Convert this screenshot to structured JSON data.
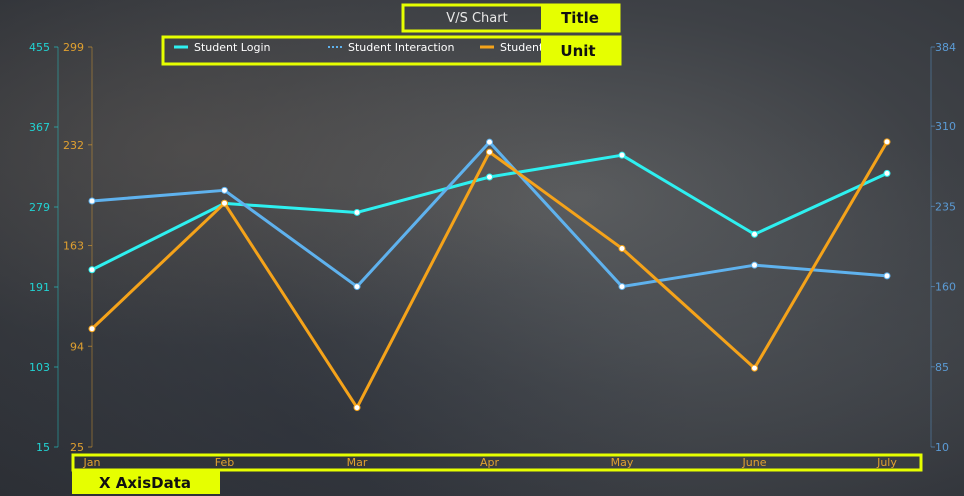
{
  "chart_data": {
    "type": "line",
    "title": "V/S Chart",
    "categories": [
      "Jan",
      "Feb",
      "Mar",
      "Apr",
      "May",
      "June",
      "July"
    ],
    "axes": {
      "y_left_outer": {
        "ticks": [
          15,
          103,
          191,
          279,
          367,
          455
        ],
        "range": [
          15,
          455
        ],
        "color": "#22d3d3"
      },
      "y_left_inner": {
        "ticks": [
          25,
          94,
          163,
          232,
          299
        ],
        "range": [
          25,
          299
        ],
        "color": "#e0a030"
      },
      "y_right": {
        "ticks": [
          10,
          85,
          160,
          235,
          310,
          384
        ],
        "range": [
          10,
          384
        ],
        "color": "#5b9bd5"
      }
    },
    "series": [
      {
        "name": "Student Login",
        "axis": "y_left_outer",
        "color": "#2ef0f0",
        "values": [
          210,
          283,
          273,
          312,
          336,
          249,
          316
        ]
      },
      {
        "name": "Student Interaction",
        "axis": "y_right",
        "color": "#5fb2ee",
        "values": [
          240,
          250,
          160,
          295,
          160,
          180,
          170
        ]
      },
      {
        "name": "Student",
        "axis": "y_left_inner",
        "color": "#f5a31a",
        "values": [
          106,
          192,
          52,
          227,
          161,
          79,
          234
        ]
      }
    ],
    "annotations": {
      "title_label": "Title",
      "unit_label": "Unit",
      "xaxis_label": "X AxisData"
    },
    "highlight_color": "#e6ff00",
    "grid": false,
    "legend_position": "top"
  }
}
